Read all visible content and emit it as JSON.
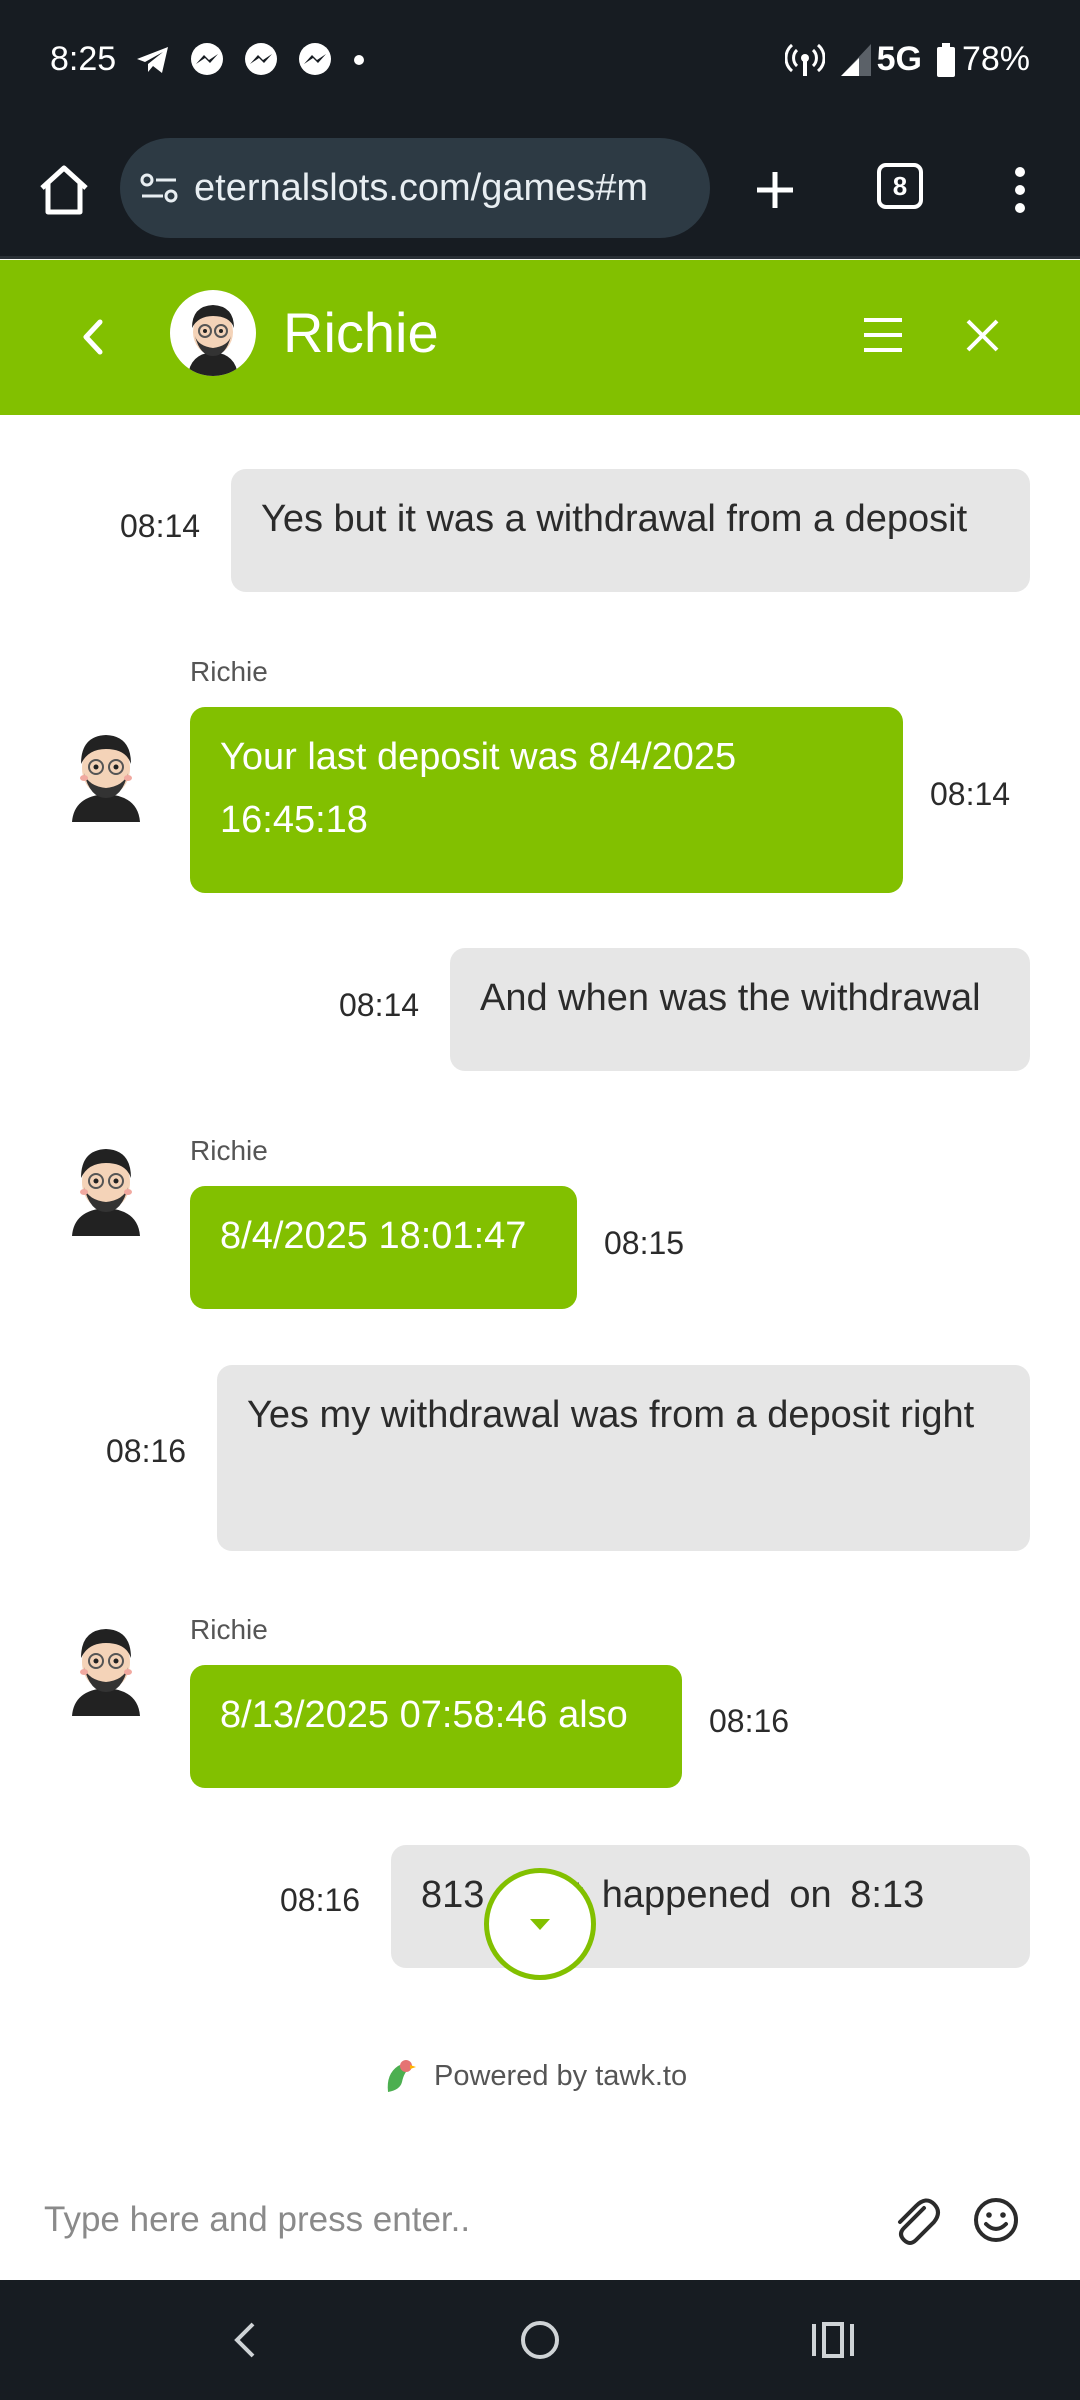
{
  "status_bar": {
    "time": "8:25",
    "network": "5G",
    "battery": "78%",
    "left_icons": [
      "telegram-icon",
      "messenger-icon",
      "messenger-icon",
      "messenger-icon",
      "dot-icon"
    ],
    "right_icons": [
      "hotspot-icon",
      "signal-icon",
      "battery-icon"
    ]
  },
  "browser": {
    "url": "eternalslots.com/games#m",
    "tab_count": "8"
  },
  "chat_header": {
    "agent_name": "Richie",
    "accent_color": "#82c000"
  },
  "messages": [
    {
      "from": "visitor",
      "text": "Yes but it was a withdrawal from a deposit",
      "time": "08:14"
    },
    {
      "from": "agent",
      "sender": "Richie",
      "text": "Your last deposit was 8/4/2025 16:45:18",
      "time": "08:14"
    },
    {
      "from": "visitor",
      "text": "And when was the withdrawal",
      "time": "08:14"
    },
    {
      "from": "agent",
      "sender": "Richie",
      "text": "8/4/2025 18:01:47",
      "time": "08:15"
    },
    {
      "from": "visitor",
      "text": "Yes my withdrawal was from a deposit right",
      "time": "08:16"
    },
    {
      "from": "agent",
      "sender": "Richie",
      "text": "8/13/2025 07:58:46 also",
      "time": "08:16"
    },
    {
      "from": "visitor",
      "text": "813 what happened on 8:13",
      "time": "08:16"
    }
  ],
  "footer": {
    "powered_by": "Powered by tawk.to"
  },
  "composer": {
    "placeholder": "Type here and press enter.."
  }
}
